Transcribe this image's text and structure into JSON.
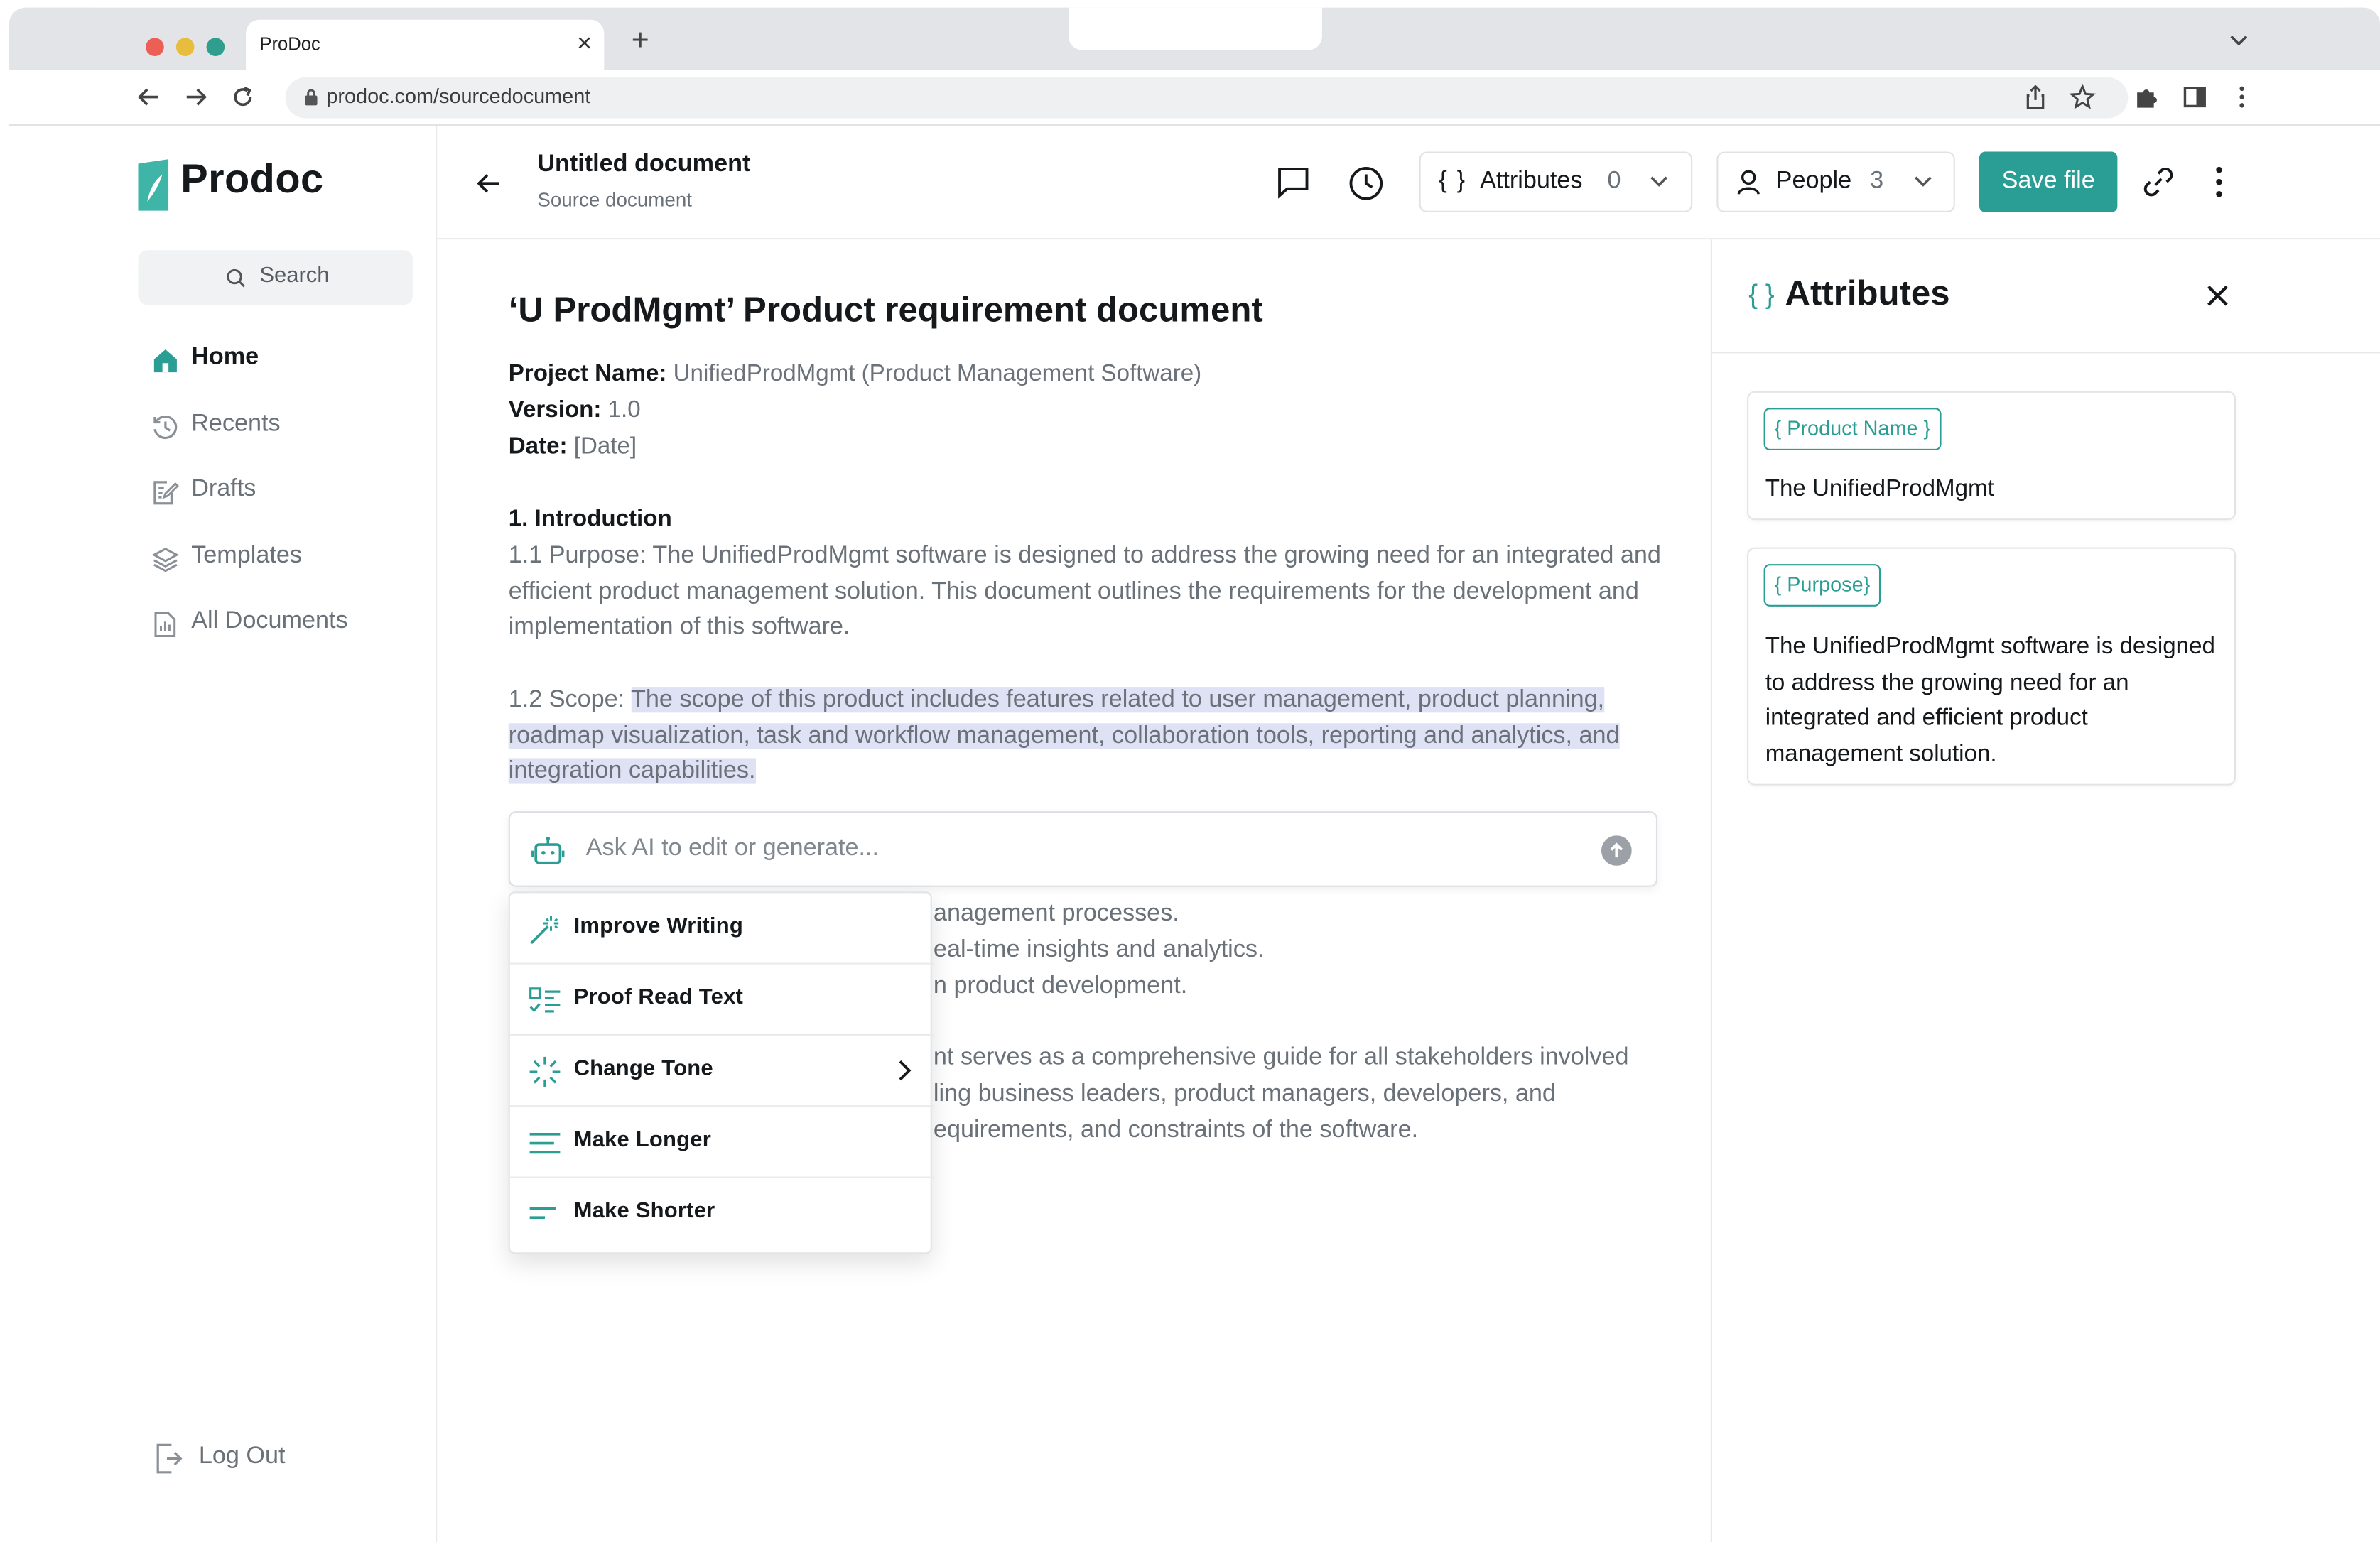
{
  "browser": {
    "tab_title": "ProDoc",
    "url": "prodoc.com/sourcedocument"
  },
  "sidebar": {
    "brand": "Prodoc",
    "search_label": "Search",
    "items": [
      {
        "label": "Home",
        "icon": "home-icon",
        "active": true
      },
      {
        "label": "Recents",
        "icon": "history-icon"
      },
      {
        "label": "Drafts",
        "icon": "drafts-icon"
      },
      {
        "label": "Templates",
        "icon": "layers-icon"
      },
      {
        "label": "All Documents",
        "icon": "documents-icon"
      }
    ],
    "logout_label": "Log Out"
  },
  "header": {
    "title": "Untitled document",
    "subtitle": "Source document",
    "attributes_label": "Attributes",
    "attributes_count": "0",
    "people_label": "People",
    "people_count": "3",
    "save_label": "Save file"
  },
  "document": {
    "heading": "‘U ProdMgmt’ Product requirement document",
    "project_name_label": "Project Name:",
    "project_name_value": " UnifiedProdMgmt (Product Management Software)",
    "version_label": "Version:",
    "version_value": " 1.0",
    "date_label": "Date:",
    "date_value": " [Date]",
    "intro_heading": "1. Introduction",
    "purpose_text": "1.1 Purpose: The UnifiedProdMgmt software is designed to address the growing need for an integrated and efficient product management solution. This document outlines the requirements for the development and implementation of this software.",
    "scope_prefix": "1.2 Scope: ",
    "scope_selected": "The scope of this product includes features related to user management, product planning, roadmap visualization, task and workflow management, collaboration tools, reporting and analytics, and integration capabilities.",
    "partial_lines": [
      "anagement processes.",
      "eal-time insights and analytics.",
      "n product development.",
      "nt serves as a comprehensive guide for all stakeholders involved",
      "ling business leaders, product managers, developers, and",
      "equirements, and constraints of the software."
    ]
  },
  "ai": {
    "placeholder": "Ask AI to edit or generate...",
    "menu": [
      {
        "label": "Improve Writing",
        "icon": "magic-wand-icon"
      },
      {
        "label": "Proof Read Text",
        "icon": "checklist-icon"
      },
      {
        "label": "Change Tone",
        "icon": "loader-icon",
        "submenu": true
      },
      {
        "label": "Make Longer",
        "icon": "lines-long-icon"
      },
      {
        "label": "Make Shorter",
        "icon": "lines-short-icon"
      }
    ]
  },
  "attributes_panel": {
    "brace": "{ }",
    "title": "Attributes",
    "cards": [
      {
        "tag": "{ Product Name }",
        "value": "The UnifiedProdMgmt"
      },
      {
        "tag": "{ Purpose}",
        "value": "The UnifiedProdMgmt software is designed to address the growing need for an integrated and efficient product management solution."
      }
    ]
  },
  "colors": {
    "accent": "#2a9d94",
    "selection": "#dfe1f5"
  }
}
